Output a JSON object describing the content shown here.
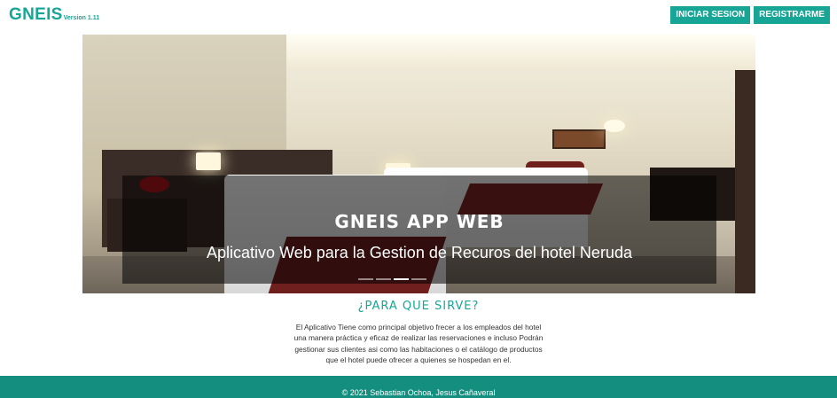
{
  "brand": {
    "name": "GNEIS",
    "version": "Version 1.11"
  },
  "auth": {
    "login_label": "INICIAR SESION",
    "register_label": "REGISTRARME"
  },
  "hero": {
    "title": "GNEIS APP WEB",
    "subtitle": "Aplicativo Web para la Gestion de Recuros del hotel Neruda",
    "slide_count": 4,
    "active_slide": 3
  },
  "info": {
    "title": "¿PARA QUE SIRVE?",
    "lines": [
      "El Aplicativo Tiene como principal objetivo frecer a los empleados del hotel",
      "una manera práctica y eficaz de realizar las reservaciones e incluso Podrán",
      "gestionar sus clientes asi como las habitaciones o el catálogo de productos",
      "que el hotel puede ofrecer a quienes se hospedan en el."
    ]
  },
  "footer": {
    "text": "© 2021 Sebastian Ochoa, Jesus Cañaveral"
  },
  "colors": {
    "accent": "#17a596",
    "footer_bg": "#148f7f"
  }
}
